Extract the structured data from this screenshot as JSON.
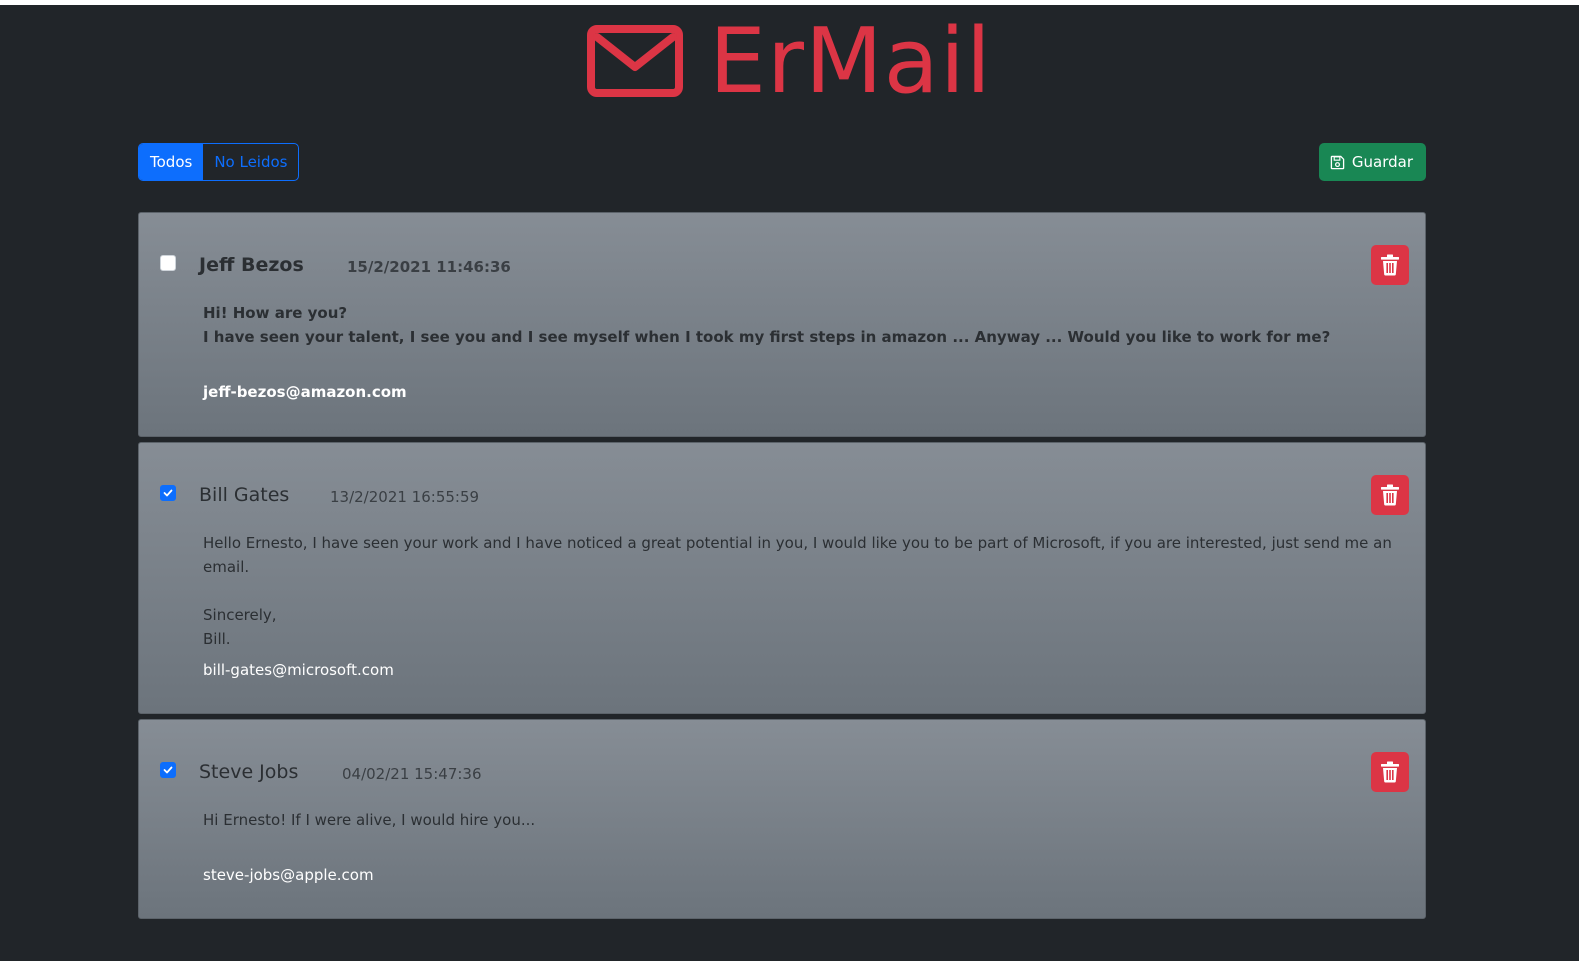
{
  "app": {
    "title": "ErMail",
    "accent_color": "#dc3545"
  },
  "filters": {
    "all_label": "Todos",
    "unread_label": "No Leidos",
    "active": "Todos"
  },
  "toolbar": {
    "save_label": "Guardar",
    "save_icon": "floppy-disk-icon"
  },
  "mails": [
    {
      "sender": "Jeff Bezos",
      "date": "15/2/2021 11:46:36",
      "body": "Hi! How are you?\nI have seen your talent, I see you and I see myself when I took my first steps in amazon ... Anyway ... Would you like to work for me?",
      "email": "jeff-bezos@amazon.com",
      "checked": false,
      "read": false
    },
    {
      "sender": "Bill Gates",
      "date": "13/2/2021 16:55:59",
      "body": "Hello Ernesto, I have seen your work and I have noticed a great potential in you, I would like you to be part of Microsoft, if you are interested, just send me an email.\n\nSincerely,\nBill.",
      "email": "bill-gates@microsoft.com",
      "checked": true,
      "read": true
    },
    {
      "sender": "Steve Jobs",
      "date": "04/02/21 15:47:36",
      "body": "Hi Ernesto! If I were alive, I would hire you...",
      "email": "steve-jobs@apple.com",
      "checked": true,
      "read": true
    }
  ],
  "icons": {
    "logo": "envelope-icon",
    "delete": "trash-icon",
    "checkbox": "check-icon"
  }
}
